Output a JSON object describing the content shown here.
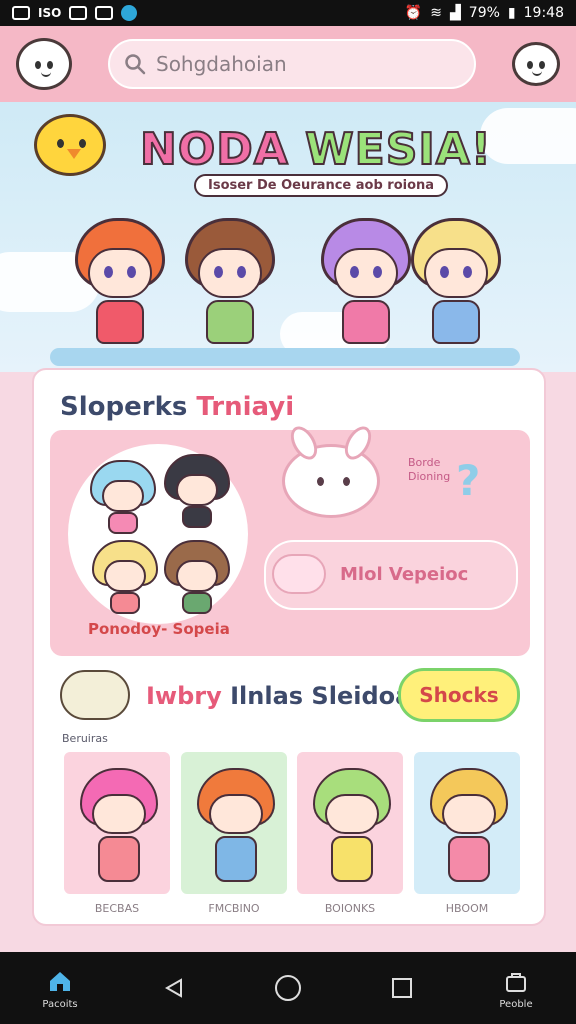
{
  "status_bar": {
    "left_badge": "ISO",
    "battery": "79%",
    "time": "19:48"
  },
  "search": {
    "value": "Sohgdahoian"
  },
  "hero": {
    "title_a": "NODA",
    "title_b": "WESIA!",
    "subtitle": "Isoser De Oeurance aob roiona"
  },
  "feature": {
    "section_title_a": "Sloperks",
    "section_title_b": "Trniayi",
    "group_label": "Ponodoy- Sopeia",
    "badge_line1": "Borde",
    "badge_line2": "Dioning",
    "pill_text": "Mlol Vepeioc"
  },
  "row": {
    "title_a": "Iwbry",
    "title_b": "Ilnlas Sleidoar:",
    "check_button": "Shocks",
    "small_label": "Beruiras",
    "thumbs": [
      {
        "label": "BECBAS",
        "bg": "#fbd3de",
        "hair": "#f46ab4",
        "body": "#f58a94"
      },
      {
        "label": "FMCBINO",
        "bg": "#d8f1d6",
        "hair": "#f07a3c",
        "body": "#7fb7e6"
      },
      {
        "label": "BOIONKS",
        "bg": "#fbd3de",
        "hair": "#a8de7c",
        "body": "#f7e16a"
      },
      {
        "label": "HBOOM",
        "bg": "#d3ecf8",
        "hair": "#f4c85a",
        "body": "#f48aa8"
      }
    ]
  },
  "bottom_nav": {
    "left_label": "Pacoits",
    "right_label": "Peoble"
  },
  "colors": {
    "app_bar": "#f5b8c6",
    "accent": "#e65b7a",
    "button": "#fff07a"
  }
}
